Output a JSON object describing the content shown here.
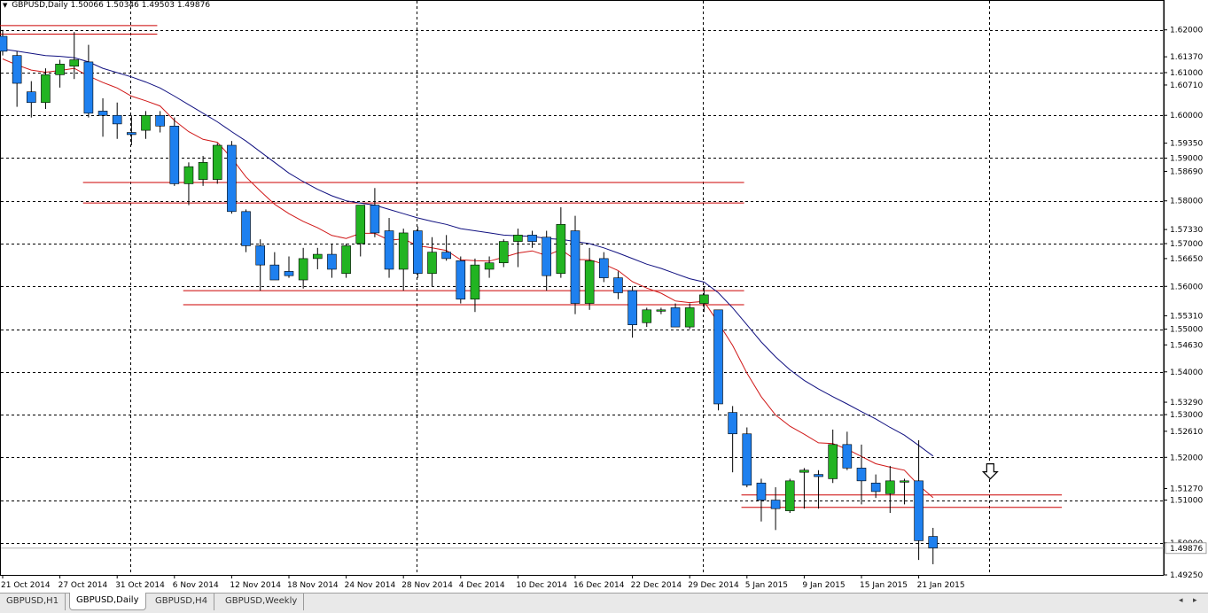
{
  "header": {
    "symbol_timeframe": "GBPUSD,Daily",
    "ohlc": "1.50066 1.50346 1.49503 1.49876"
  },
  "tabs": [
    {
      "label": "GBPUSD,H1",
      "active": false
    },
    {
      "label": "GBPUSD,Daily",
      "active": true
    },
    {
      "label": "GBPUSD,H4",
      "active": false
    },
    {
      "label": "GBPUSD,Weekly",
      "active": false
    }
  ],
  "tab_scroll": {
    "left": "◂",
    "right": "▸"
  },
  "colors": {
    "bull": "#22b422",
    "bear": "#1e80ef",
    "wick": "#000000",
    "ma_fast": "#d01818",
    "ma_slow": "#101080",
    "hline": "#cc0000",
    "grid": "#000000",
    "arrow": "#000000"
  },
  "chart_data": {
    "type": "candlestick",
    "title": "",
    "xlabel": "",
    "ylabel": "",
    "ylim": [
      1.4925,
      1.6245
    ],
    "grid": true,
    "price_ticks": [
      "1.62000",
      "1.61370",
      "1.61000",
      "1.60710",
      "1.60000",
      "1.59350",
      "1.59000",
      "1.58690",
      "1.58000",
      "1.57330",
      "1.57000",
      "1.56650",
      "1.56000",
      "1.55310",
      "1.55000",
      "1.54630",
      "1.54000",
      "1.53290",
      "1.53000",
      "1.52610",
      "1.52000",
      "1.51270",
      "1.51000",
      "1.50000",
      "1.49250"
    ],
    "current_price": "1.49876",
    "date_labels": [
      {
        "i": 0,
        "label": "21 Oct 2014"
      },
      {
        "i": 4,
        "label": "27 Oct 2014"
      },
      {
        "i": 8,
        "label": "31 Oct 2014"
      },
      {
        "i": 12,
        "label": "6 Nov 2014"
      },
      {
        "i": 16,
        "label": "12 Nov 2014"
      },
      {
        "i": 20,
        "label": "18 Nov 2014"
      },
      {
        "i": 24,
        "label": "24 Nov 2014"
      },
      {
        "i": 28,
        "label": "28 Nov 2014"
      },
      {
        "i": 32,
        "label": "4 Dec 2014"
      },
      {
        "i": 36,
        "label": "10 Dec 2014"
      },
      {
        "i": 40,
        "label": "16 Dec 2014"
      },
      {
        "i": 44,
        "label": "22 Dec 2014"
      },
      {
        "i": 48,
        "label": "29 Dec 2014"
      },
      {
        "i": 52,
        "label": "5 Jan 2015"
      },
      {
        "i": 56,
        "label": "9 Jan 2015"
      },
      {
        "i": 60,
        "label": "15 Jan 2015"
      },
      {
        "i": 64,
        "label": "21 Jan 2015"
      }
    ],
    "candles": [
      [
        1.6185,
        1.62,
        1.614,
        1.615
      ],
      [
        1.614,
        1.615,
        1.602,
        1.6075
      ],
      [
        1.6055,
        1.608,
        1.5995,
        1.603
      ],
      [
        1.603,
        1.611,
        1.6015,
        1.6095
      ],
      [
        1.6095,
        1.613,
        1.6065,
        1.612
      ],
      [
        1.6115,
        1.6195,
        1.6085,
        1.613
      ],
      [
        1.6125,
        1.6165,
        1.5995,
        1.6005
      ],
      [
        1.601,
        1.604,
        1.595,
        1.6
      ],
      [
        1.6,
        1.603,
        1.5945,
        1.598
      ],
      [
        1.596,
        1.6,
        1.593,
        1.5955
      ],
      [
        1.5965,
        1.601,
        1.5945,
        1.6
      ],
      [
        1.6,
        1.601,
        1.596,
        1.5975
      ],
      [
        1.5975,
        1.5995,
        1.5835,
        1.584
      ],
      [
        1.584,
        1.589,
        1.579,
        1.588
      ],
      [
        1.585,
        1.5905,
        1.5835,
        1.589
      ],
      [
        1.585,
        1.5935,
        1.584,
        1.593
      ],
      [
        1.593,
        1.594,
        1.577,
        1.5775
      ],
      [
        1.5775,
        1.578,
        1.568,
        1.5695
      ],
      [
        1.5695,
        1.571,
        1.559,
        1.565
      ],
      [
        1.565,
        1.568,
        1.562,
        1.5615
      ],
      [
        1.5635,
        1.567,
        1.562,
        1.5625
      ],
      [
        1.5615,
        1.569,
        1.5595,
        1.5665
      ],
      [
        1.5665,
        1.569,
        1.564,
        1.5675
      ],
      [
        1.5675,
        1.57,
        1.562,
        1.564
      ],
      [
        1.563,
        1.57,
        1.562,
        1.5695
      ],
      [
        1.57,
        1.579,
        1.567,
        1.579
      ],
      [
        1.579,
        1.583,
        1.5715,
        1.5725
      ],
      [
        1.573,
        1.576,
        1.562,
        1.564
      ],
      [
        1.564,
        1.5735,
        1.559,
        1.5725
      ],
      [
        1.573,
        1.574,
        1.562,
        1.563
      ],
      [
        1.563,
        1.5715,
        1.56,
        1.568
      ],
      [
        1.568,
        1.572,
        1.566,
        1.5665
      ],
      [
        1.566,
        1.567,
        1.556,
        1.557
      ],
      [
        1.557,
        1.5665,
        1.554,
        1.565
      ],
      [
        1.564,
        1.567,
        1.562,
        1.5655
      ],
      [
        1.5655,
        1.571,
        1.5645,
        1.5705
      ],
      [
        1.5705,
        1.5735,
        1.5645,
        1.572
      ],
      [
        1.572,
        1.573,
        1.569,
        1.5705
      ],
      [
        1.5715,
        1.573,
        1.559,
        1.5625
      ],
      [
        1.563,
        1.5785,
        1.562,
        1.5745
      ],
      [
        1.573,
        1.5765,
        1.5535,
        1.556
      ],
      [
        1.556,
        1.569,
        1.5545,
        1.566
      ],
      [
        1.5665,
        1.568,
        1.561,
        1.562
      ],
      [
        1.562,
        1.5635,
        1.557,
        1.5585
      ],
      [
        1.559,
        1.56,
        1.548,
        1.551
      ],
      [
        1.5515,
        1.555,
        1.5505,
        1.5545
      ],
      [
        1.5545,
        1.555,
        1.5535,
        1.5545
      ],
      [
        1.555,
        1.556,
        1.5505,
        1.5505
      ],
      [
        1.5505,
        1.556,
        1.55,
        1.555
      ],
      [
        1.556,
        1.56,
        1.554,
        1.558
      ],
      [
        1.5545,
        1.5545,
        1.531,
        1.5325
      ],
      [
        1.5305,
        1.532,
        1.5165,
        1.5255
      ],
      [
        1.5255,
        1.527,
        1.513,
        1.5135
      ],
      [
        1.514,
        1.515,
        1.505,
        1.51
      ],
      [
        1.51,
        1.513,
        1.503,
        1.508
      ],
      [
        1.5075,
        1.515,
        1.507,
        1.5145
      ],
      [
        1.5165,
        1.5175,
        1.508,
        1.517
      ],
      [
        1.516,
        1.517,
        1.508,
        1.5155
      ],
      [
        1.515,
        1.5265,
        1.514,
        1.523
      ],
      [
        1.523,
        1.526,
        1.517,
        1.5175
      ],
      [
        1.5175,
        1.523,
        1.509,
        1.5145
      ],
      [
        1.514,
        1.516,
        1.5105,
        1.512
      ],
      [
        1.5115,
        1.518,
        1.507,
        1.5145
      ],
      [
        1.5145,
        1.515,
        1.509,
        1.5145
      ],
      [
        1.5145,
        1.524,
        1.496,
        1.5005
      ],
      [
        1.5015,
        1.5035,
        1.495,
        1.4988
      ]
    ],
    "ma_fast_values": [
      1.6132,
      1.6118,
      1.6106,
      1.6101,
      1.6105,
      1.611,
      1.6092,
      1.6077,
      1.6064,
      1.6045,
      1.6034,
      1.6022,
      1.5988,
      1.5962,
      1.5944,
      1.5937,
      1.59,
      1.5856,
      1.5823,
      1.5792,
      1.577,
      1.5752,
      1.5737,
      1.5719,
      1.5712,
      1.5724,
      1.5724,
      1.5708,
      1.5711,
      1.5695,
      1.569,
      1.5684,
      1.5662,
      1.566,
      1.5659,
      1.5668,
      1.5678,
      1.5683,
      1.5672,
      1.5686,
      1.5663,
      1.5662,
      1.5652,
      1.5637,
      1.5611,
      1.5596,
      1.5584,
      1.5566,
      1.5562,
      1.5565,
      1.5515,
      1.5462,
      1.5397,
      1.5342,
      1.5299,
      1.5273,
      1.5254,
      1.5234,
      1.5232,
      1.5219,
      1.5202,
      1.5185,
      1.5177,
      1.517,
      1.5135,
      1.5106
    ],
    "ma_slow_values": [
      1.6155,
      1.615,
      1.6145,
      1.614,
      1.6138,
      1.6135,
      1.6125,
      1.611,
      1.61,
      1.609,
      1.6078,
      1.6064,
      1.6045,
      1.6025,
      1.6005,
      1.5985,
      1.5962,
      1.594,
      1.5915,
      1.589,
      1.5865,
      1.5845,
      1.5827,
      1.5812,
      1.58,
      1.5795,
      1.579,
      1.578,
      1.577,
      1.576,
      1.5752,
      1.5745,
      1.5735,
      1.573,
      1.5725,
      1.572,
      1.5718,
      1.5717,
      1.5712,
      1.571,
      1.5705,
      1.57,
      1.569,
      1.5678,
      1.5665,
      1.5652,
      1.5642,
      1.563,
      1.5618,
      1.561,
      1.5585,
      1.555,
      1.551,
      1.547,
      1.5435,
      1.5405,
      1.538,
      1.536,
      1.5342,
      1.5325,
      1.5307,
      1.529,
      1.527,
      1.5252,
      1.5228,
      1.5203
    ],
    "horizontal_levels": [
      {
        "price": 1.621,
        "from": 0,
        "to": 10.8
      },
      {
        "price": 1.619,
        "from": 0,
        "to": 10.8
      },
      {
        "price": 1.5843,
        "from": 5.8,
        "to": 51.8
      },
      {
        "price": 1.5795,
        "from": 5.8,
        "to": 51.8
      },
      {
        "price": 1.559,
        "from": 12.8,
        "to": 51.8
      },
      {
        "price": 1.5557,
        "from": 12.8,
        "to": 51.8
      },
      {
        "price": 1.5112,
        "from": 51.8,
        "to": 74.0
      },
      {
        "price": 1.5083,
        "from": 51.8,
        "to": 74.0
      }
    ],
    "annotations": [
      {
        "kind": "down-arrow",
        "at": 69.0,
        "price": 1.516
      }
    ]
  }
}
